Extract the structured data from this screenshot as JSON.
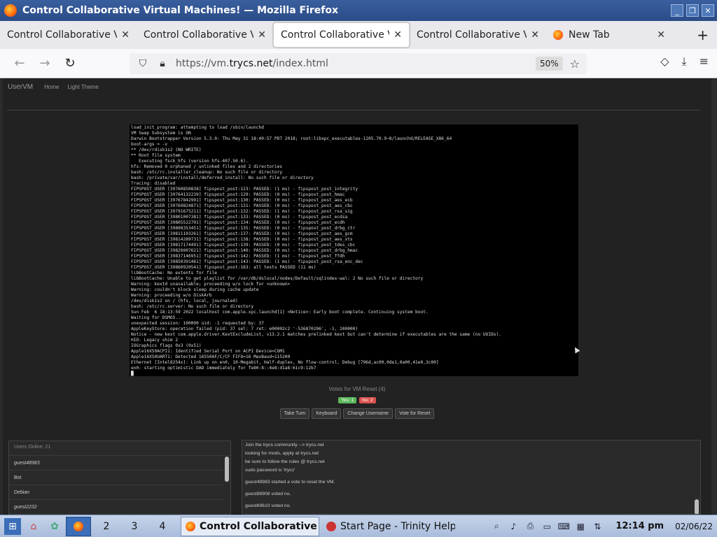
{
  "window": {
    "title": "Control Collaborative Virtual Machines! — Mozilla Firefox",
    "min": "_",
    "max": "❐",
    "close": "✕"
  },
  "tabs": [
    {
      "label": "Control Collaborative Vi",
      "active": false
    },
    {
      "label": "Control Collaborative Vi",
      "active": false
    },
    {
      "label": "Control Collaborative Vi",
      "active": true
    },
    {
      "label": "Control Collaborative Vi",
      "active": false
    },
    {
      "label": "New Tab",
      "active": false
    }
  ],
  "tab_close": "✕",
  "new_tab_button": "+",
  "nav": {
    "back": "←",
    "forward": "→",
    "reload": "↻",
    "url_prefix": "https://vm.",
    "url_domain": "trycs.net",
    "url_path": "/index.html",
    "zoom": "50%",
    "star": "☆",
    "pocket": "◇",
    "download": "⤓",
    "menu": "≡"
  },
  "page": {
    "brand": "UserVM",
    "links": [
      "Home",
      "Light Theme"
    ],
    "console_lines": [
      "load_init_program: attempting to load /sbin/launchd",
      "VM Swap Subsystem is ON",
      "Darwin Bootstrapper Version 5.3.0: Thu May 31 18:40:57 PDT 2018; root:libxpc_executables-1205.70.9~8/launchd/RELEASE_X86_64",
      "boot-args = -v",
      "** /dev/rdisk1s2 (NO WRITE)",
      "** Root file system",
      "   Executing fsck_hfs (version hfs-407.50.6).",
      "hfs: Removed 0 orphaned / unlinked files and 2 directories",
      "bash: /etc/rc.installer_cleanup: No such file or directory",
      "bash: /private/var/install/deferred_install: No such file or directory",
      "Tracing: disabled",
      "FIPSPOST_USER [39760850838] fipspost_post:123: PASSED: (1 ms) - fipspost_post_integrity",
      "FIPSPOST_USER [39764132239] fipspost_post:129: PASSED: (0 ms) - fipspost_post_hmac",
      "FIPSPOST_USER [39767842991] fipspost_post:130: PASSED: (0 ms) - fipspost_post_aes_ecb",
      "FIPSPOST_USER [39769824871] fipspost_post:131: PASSED: (0 ms) - fipspost_post_aes_cbc",
      "FIPSPOST_USER [39791675211] fipspost_post:132: PASSED: (1 ms) - fipspost_post_rsa_sig",
      "FIPSPOST_USER [39801007381] fipspost_post:133: PASSED: (0 ms) - fipspost_post_ecdsa",
      "FIPSPOST_USER [39805522701] fipspost_post:134: PASSED: (0 ms) - fipspost_post_ecdh",
      "FIPSPOST_USER [39808353451] fipspost_post:135: PASSED: (0 ms) - fipspost_post_drbg_ctr",
      "FIPSPOST_USER [39811103261] fipspost_post:137: PASSED: (0 ms) - fipspost_post_aes_gcm",
      "FIPSPOST_USER [39814289731] fipspost_post:138: PASSED: (0 ms) - fipspost_post_aes_xts",
      "FIPSPOST_USER [39817174491] fipspost_post:139: PASSED: (0 ms) - fipspost_post_tdes_cbc",
      "FIPSPOST_USER [39820007621] fipspost_post:140: PASSED: (0 ms) - fipspost_post_drbg_hmac",
      "FIPSPOST_USER [39837146951] fipspost_post:142: PASSED: (1 ms) - fipspost_post_ffdh",
      "FIPSPOST_USER [39850391461] fipspost_post:143: PASSED: (1 ms) - fipspost_post_rsa_enc_dec",
      "FIPSPOST_USER [39860920541] fipspost_post:163: all tests PASSED (11 ms)",
      "libBootCache: No extents for file",
      "libBootCache: Unable to get playlist for /var/db/dslocal/nodes/Default/sqlindex-wal: 2 No such file or directory",
      "Warning: kextd unavailable; proceeding w/o lock for <unknown>",
      "Warning: couldn't block sleep during cache update",
      "Warning: proceeding w/o DiskArb",
      "/dev/disk1s2 on / (hfs, local, journaled)",
      "bash: /etc/rc.server: No such file or directory",
      "Sun Feb  6 18:13:59 2022 localhost com.apple.xpc.launchd[1] <Notice>: Early boot complete. Continuing system boot.",
      "Waiting for DSMOS...",
      "unexpected session: 100000 uid: -1 requested by: 37",
      "AppleKeyStore: operation failed (pid: 37 sel: 7 ret: e00002c2 '-536870206', -1, 100000)",
      "Notice - new kext com.apple.driver.KextExcludeList, v13.2.1 matches prelinked kext but can't determine if executables are the same (no UUIDs).",
      "HID: Legacy shim 2",
      "IOGraphics flags 0x3 (0x51)",
      "Apple16X50ACPI1: Identified Serial Port on ACPI Device=COM1",
      "Apple16X50UART1: Detected 16550AF/C/CF FIFO=16 MaxBaud=115200",
      "Ethernet [Intel8254x]: Link up on en0, 10-Megabit, Half-duplex, No flow-control, Debug [796d,ac00,0de1,0a00,41e0,3c00]",
      "en0: starting optimistic DAD immediately for fe80:8::4e8:d1a8:61c9:12b7",
      "█"
    ],
    "votes_title": "Votes for VM Reset (4)",
    "vote_yes": "Yes: 1",
    "vote_no": "No: 2",
    "buttons": [
      "Take Turn",
      "Keyboard",
      "Change Username",
      "Vote for Reset"
    ],
    "users_header": "Users Online: 21",
    "users": [
      {
        "name": "guest48983",
        "italic": true
      },
      {
        "name": "Bot",
        "italic": false
      },
      {
        "name": "Debian",
        "italic": false
      },
      {
        "name": "guest2232",
        "italic": true
      }
    ],
    "chat": [
      "Join the trycs community --> trycs.net",
      "looking for mods, apply at trycs.net",
      "be sure to follow the rules @ trycs.net",
      "sudo password is 'trycs'",
      "guest48983 started a vote to reset the VM.",
      "guest88908 voted no.",
      "guest69610 voted no."
    ]
  },
  "taskbar": {
    "workspaces": [
      "2",
      "3",
      "4"
    ],
    "task_active": "Control Collaborative Vi",
    "task_inactive": "Start Page - Trinity Help C",
    "clock": "12:14 pm",
    "date": "02/06/22"
  },
  "colors": {
    "titlebar": "#3a5f9e",
    "page_bg": "#222222",
    "vote_yes": "#5cb85c",
    "vote_no": "#d9534f"
  }
}
